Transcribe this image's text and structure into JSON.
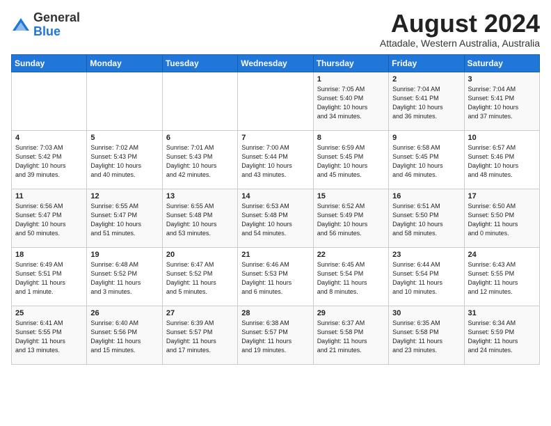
{
  "header": {
    "logo_general": "General",
    "logo_blue": "Blue",
    "month_year": "August 2024",
    "location": "Attadale, Western Australia, Australia"
  },
  "days_of_week": [
    "Sunday",
    "Monday",
    "Tuesday",
    "Wednesday",
    "Thursday",
    "Friday",
    "Saturday"
  ],
  "weeks": [
    [
      {
        "day": "",
        "info": ""
      },
      {
        "day": "",
        "info": ""
      },
      {
        "day": "",
        "info": ""
      },
      {
        "day": "",
        "info": ""
      },
      {
        "day": "1",
        "info": "Sunrise: 7:05 AM\nSunset: 5:40 PM\nDaylight: 10 hours\nand 34 minutes."
      },
      {
        "day": "2",
        "info": "Sunrise: 7:04 AM\nSunset: 5:41 PM\nDaylight: 10 hours\nand 36 minutes."
      },
      {
        "day": "3",
        "info": "Sunrise: 7:04 AM\nSunset: 5:41 PM\nDaylight: 10 hours\nand 37 minutes."
      }
    ],
    [
      {
        "day": "4",
        "info": "Sunrise: 7:03 AM\nSunset: 5:42 PM\nDaylight: 10 hours\nand 39 minutes."
      },
      {
        "day": "5",
        "info": "Sunrise: 7:02 AM\nSunset: 5:43 PM\nDaylight: 10 hours\nand 40 minutes."
      },
      {
        "day": "6",
        "info": "Sunrise: 7:01 AM\nSunset: 5:43 PM\nDaylight: 10 hours\nand 42 minutes."
      },
      {
        "day": "7",
        "info": "Sunrise: 7:00 AM\nSunset: 5:44 PM\nDaylight: 10 hours\nand 43 minutes."
      },
      {
        "day": "8",
        "info": "Sunrise: 6:59 AM\nSunset: 5:45 PM\nDaylight: 10 hours\nand 45 minutes."
      },
      {
        "day": "9",
        "info": "Sunrise: 6:58 AM\nSunset: 5:45 PM\nDaylight: 10 hours\nand 46 minutes."
      },
      {
        "day": "10",
        "info": "Sunrise: 6:57 AM\nSunset: 5:46 PM\nDaylight: 10 hours\nand 48 minutes."
      }
    ],
    [
      {
        "day": "11",
        "info": "Sunrise: 6:56 AM\nSunset: 5:47 PM\nDaylight: 10 hours\nand 50 minutes."
      },
      {
        "day": "12",
        "info": "Sunrise: 6:55 AM\nSunset: 5:47 PM\nDaylight: 10 hours\nand 51 minutes."
      },
      {
        "day": "13",
        "info": "Sunrise: 6:55 AM\nSunset: 5:48 PM\nDaylight: 10 hours\nand 53 minutes."
      },
      {
        "day": "14",
        "info": "Sunrise: 6:53 AM\nSunset: 5:48 PM\nDaylight: 10 hours\nand 54 minutes."
      },
      {
        "day": "15",
        "info": "Sunrise: 6:52 AM\nSunset: 5:49 PM\nDaylight: 10 hours\nand 56 minutes."
      },
      {
        "day": "16",
        "info": "Sunrise: 6:51 AM\nSunset: 5:50 PM\nDaylight: 10 hours\nand 58 minutes."
      },
      {
        "day": "17",
        "info": "Sunrise: 6:50 AM\nSunset: 5:50 PM\nDaylight: 11 hours\nand 0 minutes."
      }
    ],
    [
      {
        "day": "18",
        "info": "Sunrise: 6:49 AM\nSunset: 5:51 PM\nDaylight: 11 hours\nand 1 minute."
      },
      {
        "day": "19",
        "info": "Sunrise: 6:48 AM\nSunset: 5:52 PM\nDaylight: 11 hours\nand 3 minutes."
      },
      {
        "day": "20",
        "info": "Sunrise: 6:47 AM\nSunset: 5:52 PM\nDaylight: 11 hours\nand 5 minutes."
      },
      {
        "day": "21",
        "info": "Sunrise: 6:46 AM\nSunset: 5:53 PM\nDaylight: 11 hours\nand 6 minutes."
      },
      {
        "day": "22",
        "info": "Sunrise: 6:45 AM\nSunset: 5:54 PM\nDaylight: 11 hours\nand 8 minutes."
      },
      {
        "day": "23",
        "info": "Sunrise: 6:44 AM\nSunset: 5:54 PM\nDaylight: 11 hours\nand 10 minutes."
      },
      {
        "day": "24",
        "info": "Sunrise: 6:43 AM\nSunset: 5:55 PM\nDaylight: 11 hours\nand 12 minutes."
      }
    ],
    [
      {
        "day": "25",
        "info": "Sunrise: 6:41 AM\nSunset: 5:55 PM\nDaylight: 11 hours\nand 13 minutes."
      },
      {
        "day": "26",
        "info": "Sunrise: 6:40 AM\nSunset: 5:56 PM\nDaylight: 11 hours\nand 15 minutes."
      },
      {
        "day": "27",
        "info": "Sunrise: 6:39 AM\nSunset: 5:57 PM\nDaylight: 11 hours\nand 17 minutes."
      },
      {
        "day": "28",
        "info": "Sunrise: 6:38 AM\nSunset: 5:57 PM\nDaylight: 11 hours\nand 19 minutes."
      },
      {
        "day": "29",
        "info": "Sunrise: 6:37 AM\nSunset: 5:58 PM\nDaylight: 11 hours\nand 21 minutes."
      },
      {
        "day": "30",
        "info": "Sunrise: 6:35 AM\nSunset: 5:58 PM\nDaylight: 11 hours\nand 23 minutes."
      },
      {
        "day": "31",
        "info": "Sunrise: 6:34 AM\nSunset: 5:59 PM\nDaylight: 11 hours\nand 24 minutes."
      }
    ]
  ]
}
